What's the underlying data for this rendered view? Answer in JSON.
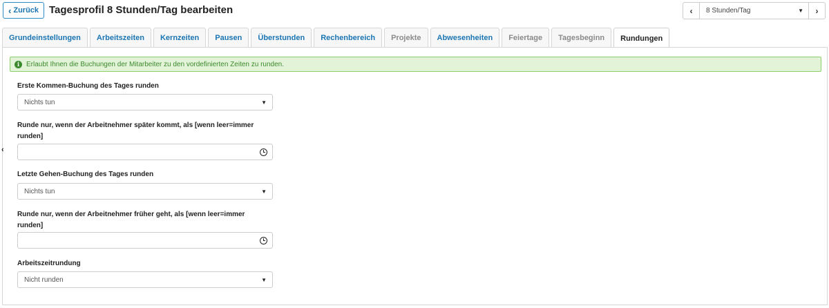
{
  "header": {
    "back_label": "Zurück",
    "title": "Tagesprofil 8 Stunden/Tag bearbeiten",
    "profile_selected": "8 Stunden/Tag"
  },
  "tabs": [
    {
      "label": "Grundeinstellungen",
      "state": "enabled"
    },
    {
      "label": "Arbeitszeiten",
      "state": "enabled"
    },
    {
      "label": "Kernzeiten",
      "state": "enabled"
    },
    {
      "label": "Pausen",
      "state": "enabled"
    },
    {
      "label": "Überstunden",
      "state": "enabled"
    },
    {
      "label": "Rechenbereich",
      "state": "enabled"
    },
    {
      "label": "Projekte",
      "state": "disabled"
    },
    {
      "label": "Abwesenheiten",
      "state": "enabled"
    },
    {
      "label": "Feiertage",
      "state": "disabled"
    },
    {
      "label": "Tagesbeginn",
      "state": "disabled"
    },
    {
      "label": "Rundungen",
      "state": "active"
    }
  ],
  "alert": {
    "text": "Erlaubt Ihnen die Buchungen der Mitarbeiter zu den vordefinierten Zeiten zu runden."
  },
  "form": {
    "first_in_label": "Erste Kommen-Buchung des Tages runden",
    "first_in_value": "Nichts tun",
    "late_threshold_label": "Runde nur, wenn der Arbeitnehmer später kommt, als [wenn leer=immer runden]",
    "late_threshold_value": "",
    "last_out_label": "Letzte Gehen-Buchung des Tages runden",
    "last_out_value": "Nichts tun",
    "early_threshold_label": "Runde nur, wenn der Arbeitnehmer früher geht, als [wenn leer=immer runden]",
    "early_threshold_value": "",
    "worktime_rounding_label": "Arbeitszeitrundung",
    "worktime_rounding_value": "Nicht runden"
  },
  "icons": {
    "back": "chevron-left-icon",
    "prev": "chevron-left-icon",
    "next": "chevron-right-icon",
    "dropdown": "caret-down-icon",
    "info": "info-circle-icon",
    "clock": "clock-icon"
  },
  "colors": {
    "link_blue": "#1b75b3",
    "alert_bg": "#e3f3d8",
    "alert_border": "#8ccf6a",
    "alert_text": "#3c8a2e"
  }
}
